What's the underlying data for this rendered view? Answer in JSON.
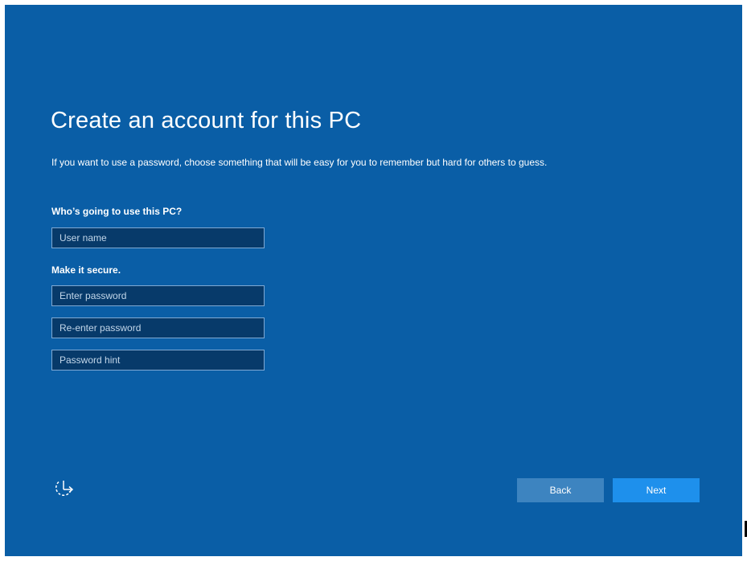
{
  "setup": {
    "title": "Create an account for this PC",
    "description": "If you want to use a password, choose something that will be easy for you to remember but hard for others to guess.",
    "user_section_label": "Who’s going to use this PC?",
    "secure_section_label": "Make it secure.",
    "fields": {
      "username_placeholder": "User name",
      "username_value": "",
      "password_placeholder": "Enter password",
      "password_value": "",
      "reenter_placeholder": "Re-enter password",
      "reenter_value": "",
      "hint_placeholder": "Password hint",
      "hint_value": ""
    },
    "accessibility_icon": "ease-of-access-icon",
    "buttons": {
      "back": "Back",
      "next": "Next"
    },
    "colors": {
      "background": "#0a5ea6",
      "field_background": "#073a6a",
      "field_border": "#7fa9d3",
      "back_button": "#3d84c0",
      "next_button": "#1e90ec",
      "text": "#ffffff"
    }
  }
}
